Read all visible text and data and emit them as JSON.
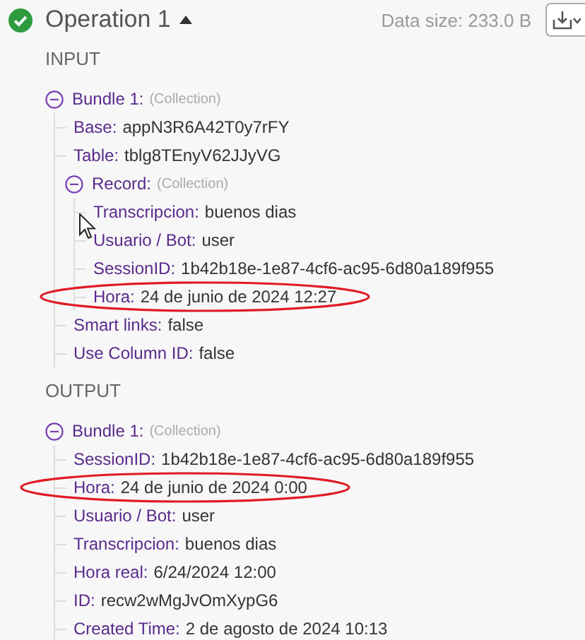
{
  "operation": {
    "title": "Operation 1",
    "expanded": true,
    "data_size": "Data size: 233.0 B"
  },
  "sections": [
    {
      "title": "INPUT",
      "bundles": [
        {
          "label": "Bundle 1:",
          "type_note": "(Collection)",
          "expanded": true,
          "items": [
            {
              "key": "Base:",
              "value": "appN3R6A42T0y7rFY"
            },
            {
              "key": "Table:",
              "value": "tblg8TEnyV62JJyVG"
            },
            {
              "key": "Record:",
              "type_note": "(Collection)",
              "expanded": true,
              "children": [
                {
                  "key": "Transcripcion:",
                  "value": "buenos dias"
                },
                {
                  "key": "Usuario / Bot:",
                  "value": "user"
                },
                {
                  "key": "SessionID:",
                  "value": "1b42b18e-1e87-4cf6-ac95-6d80a189f955"
                },
                {
                  "key": "Hora:",
                  "value": "24 de junio de 2024 12:27",
                  "highlighted": true
                }
              ]
            },
            {
              "key": "Smart links:",
              "value": "false"
            },
            {
              "key": "Use Column ID:",
              "value": "false"
            }
          ]
        }
      ]
    },
    {
      "title": "OUTPUT",
      "bundles": [
        {
          "label": "Bundle 1:",
          "type_note": "(Collection)",
          "expanded": true,
          "items": [
            {
              "key": "SessionID:",
              "value": "1b42b18e-1e87-4cf6-ac95-6d80a189f955"
            },
            {
              "key": "Hora:",
              "value": "24 de junio de 2024 0:00",
              "highlighted": true
            },
            {
              "key": "Usuario / Bot:",
              "value": "user"
            },
            {
              "key": "Transcripcion:",
              "value": "buenos dias"
            },
            {
              "key": "Hora real:",
              "value": "6/24/2024 12:00"
            },
            {
              "key": "ID:",
              "value": "recw2wMgJvOmXypG6"
            },
            {
              "key": "Created Time:",
              "value": "2 de agosto de 2024 10:13"
            }
          ]
        }
      ]
    }
  ]
}
